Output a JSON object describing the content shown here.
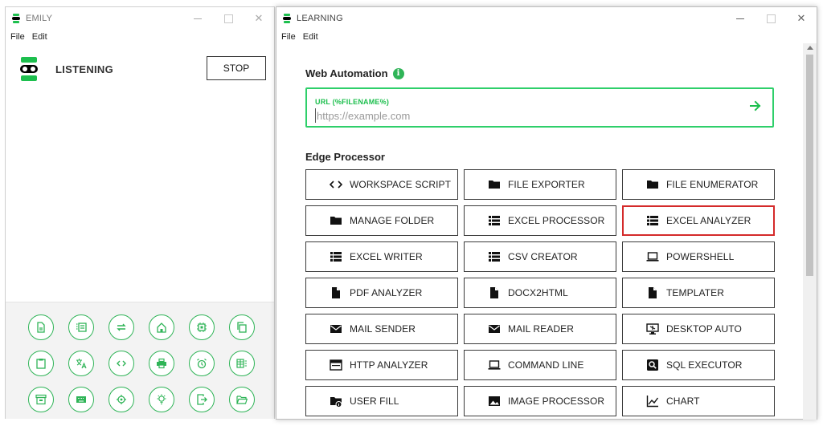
{
  "left_window": {
    "title": "EMILY",
    "menu": [
      "File",
      "Edit"
    ],
    "status": "LISTENING",
    "stop_label": "STOP",
    "tools": [
      "document-icon",
      "list-icon",
      "repeat-icon",
      "home-icon",
      "chip-icon",
      "copy-icon",
      "clipboard-icon",
      "translate-icon",
      "code-icon",
      "printer-icon",
      "alarm-icon",
      "table-icon",
      "archive-icon",
      "keyboard-icon",
      "crosshair-icon",
      "lightbulb-icon",
      "export-icon",
      "folder-open-icon"
    ]
  },
  "right_window": {
    "title": "LEARNING",
    "menu": [
      "File",
      "Edit"
    ],
    "web_automation": {
      "title": "Web Automation",
      "info": "i",
      "url_label": "URL (%FILENAME%)",
      "url_placeholder": "https://example.com",
      "url_value": ""
    },
    "edge_processor": {
      "title": "Edge Processor",
      "buttons": [
        {
          "label": "WORKSPACE SCRIPT",
          "icon": "code-icon"
        },
        {
          "label": "FILE EXPORTER",
          "icon": "folder-icon"
        },
        {
          "label": "FILE ENUMERATOR",
          "icon": "folder-icon"
        },
        {
          "label": "MANAGE FOLDER",
          "icon": "folder-icon"
        },
        {
          "label": "EXCEL PROCESSOR",
          "icon": "list-icon"
        },
        {
          "label": "EXCEL ANALYZER",
          "icon": "list-icon",
          "selected": true
        },
        {
          "label": "EXCEL WRITER",
          "icon": "list-icon"
        },
        {
          "label": "CSV CREATOR",
          "icon": "list-icon"
        },
        {
          "label": "POWERSHELL",
          "icon": "laptop-icon"
        },
        {
          "label": "PDF ANALYZER",
          "icon": "file-icon"
        },
        {
          "label": "DOCX2HTML",
          "icon": "file-icon"
        },
        {
          "label": "TEMPLATER",
          "icon": "file-icon"
        },
        {
          "label": "MAIL SENDER",
          "icon": "mail-icon"
        },
        {
          "label": "MAIL READER",
          "icon": "mail-icon"
        },
        {
          "label": "DESKTOP AUTO",
          "icon": "monitor-icon"
        },
        {
          "label": "HTTP ANALYZER",
          "icon": "browser-icon"
        },
        {
          "label": "COMMAND LINE",
          "icon": "laptop-icon"
        },
        {
          "label": "SQL EXECUTOR",
          "icon": "search-box-icon"
        },
        {
          "label": "USER FILL",
          "icon": "folder-info-icon"
        },
        {
          "label": "IMAGE PROCESSOR",
          "icon": "image-icon"
        },
        {
          "label": "CHART",
          "icon": "chart-icon"
        }
      ]
    }
  },
  "colors": {
    "accent": "#1dbf4e",
    "selected_border": "#d42a2a"
  }
}
